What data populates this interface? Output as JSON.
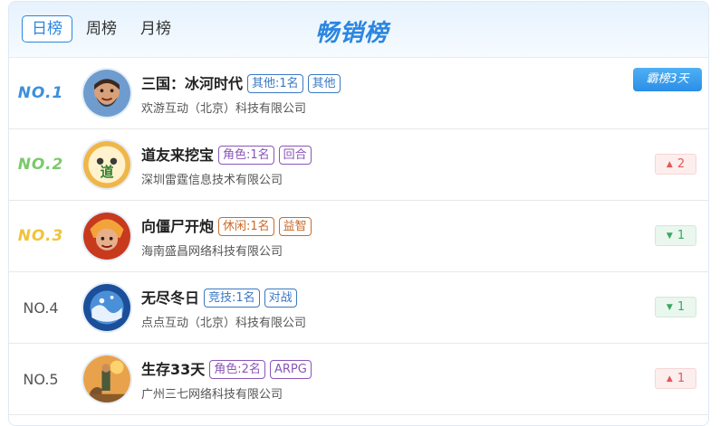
{
  "tabs": [
    {
      "label": "日榜",
      "active": true
    },
    {
      "label": "周榜",
      "active": false
    },
    {
      "label": "月榜",
      "active": false
    }
  ],
  "title": "畅销榜",
  "rows": [
    {
      "rank": "NO.1",
      "name": "三国：冰河时代",
      "tags": [
        "其他:1名",
        "其他"
      ],
      "company": "欢游互动（北京）科技有限公司",
      "badge": "霸榜3天",
      "icon": "bearded-warrior-avatar"
    },
    {
      "rank": "NO.2",
      "name": "道友来挖宝",
      "tags": [
        "角色:1名",
        "回合"
      ],
      "company": "深圳雷霆信息技术有限公司",
      "change": "2",
      "direction": "up",
      "icon": "dao-character-avatar"
    },
    {
      "rank": "NO.3",
      "name": "向僵尸开炮",
      "tags": [
        "休闲:1名",
        "益智"
      ],
      "company": "海南盛昌网络科技有限公司",
      "change": "1",
      "direction": "down",
      "icon": "fire-soldier-avatar"
    },
    {
      "rank": "NO.4",
      "name": "无尽冬日",
      "tags": [
        "竞技:1名",
        "对战"
      ],
      "company": "点点互动（北京）科技有限公司",
      "change": "1",
      "direction": "down",
      "icon": "snow-globe-avatar"
    },
    {
      "rank": "NO.5",
      "name": "生存33天",
      "tags": [
        "角色:2名",
        "ARPG"
      ],
      "company": "广州三七网络科技有限公司",
      "change": "1",
      "direction": "up",
      "icon": "survivor-dog-avatar"
    }
  ],
  "colors": {
    "accent": "#2a86e0",
    "up": "#e05858",
    "down": "#3aa860"
  }
}
